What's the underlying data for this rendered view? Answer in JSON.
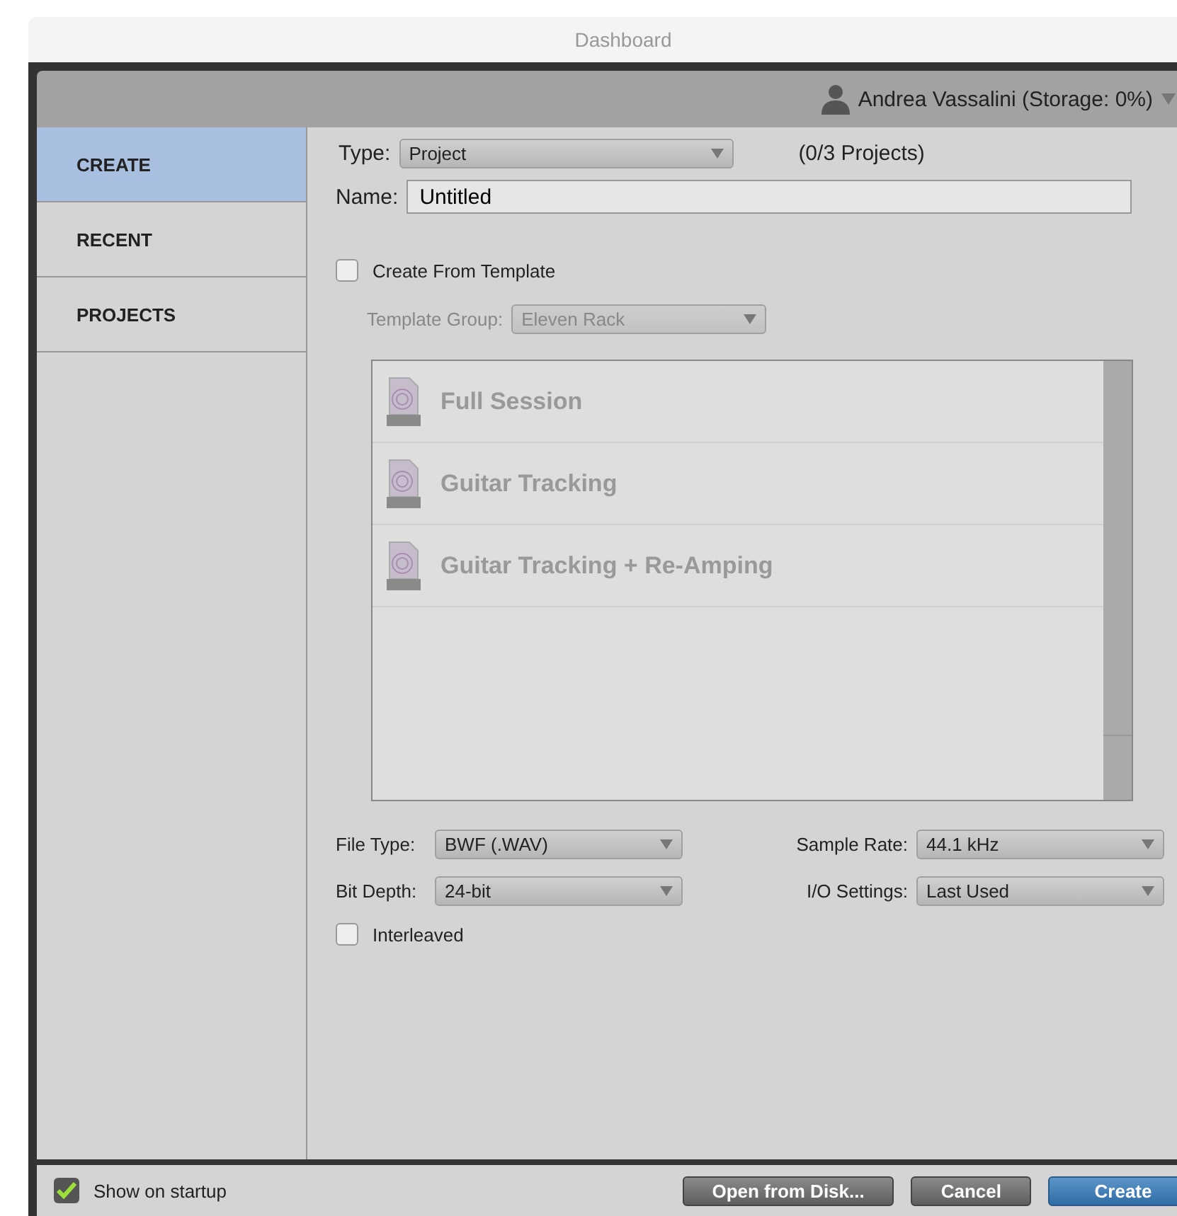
{
  "window": {
    "title": "Dashboard"
  },
  "account": {
    "name": "Andrea Vassalini (Storage: 0%)"
  },
  "sidebar": {
    "items": [
      {
        "label": "CREATE",
        "selected": true
      },
      {
        "label": "RECENT",
        "selected": false
      },
      {
        "label": "PROJECTS",
        "selected": false
      }
    ]
  },
  "form": {
    "type": {
      "label": "Type:",
      "value": "Project",
      "disabled": false
    },
    "type_count": "(0/3 Projects)",
    "name": {
      "label": "Name:",
      "value": "Untitled"
    },
    "template_checkbox": {
      "label": "Create From Template",
      "checked": false
    },
    "template_group": {
      "label": "Template Group:",
      "value": "Eleven Rack",
      "disabled": true
    },
    "templates_disabled": true,
    "templates": [
      {
        "name": "Full Session"
      },
      {
        "name": "Guitar Tracking"
      },
      {
        "name": "Guitar Tracking + Re-Amping"
      }
    ],
    "settings": [
      {
        "label": "File Type:",
        "value": "BWF (.WAV)"
      },
      {
        "label": "Sample Rate:",
        "value": "44.1 kHz"
      },
      {
        "label": "Bit Depth:",
        "value": "24-bit"
      },
      {
        "label": "I/O Settings:",
        "value": "Last Used"
      }
    ],
    "interleaved": {
      "label": "Interleaved",
      "checked": false
    }
  },
  "footer": {
    "show_on_startup": {
      "label": "Show on startup",
      "checked": true
    },
    "buttons": [
      {
        "label": "Open from Disk...",
        "kind": "normal"
      },
      {
        "label": "Cancel",
        "kind": "normal"
      },
      {
        "label": "Create",
        "kind": "primary"
      }
    ]
  }
}
